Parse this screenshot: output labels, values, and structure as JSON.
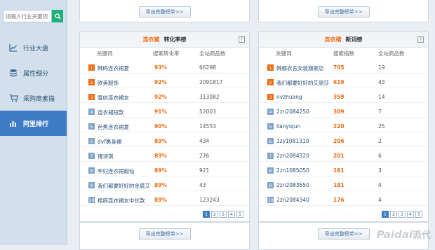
{
  "search": {
    "placeholder": "请输入行业关键词"
  },
  "menu": [
    {
      "label": "行业大盘",
      "icon": "chart-line-icon"
    },
    {
      "label": "属性细分",
      "icon": "layers-icon"
    },
    {
      "label": "采购商素描",
      "icon": "cart-icon"
    },
    {
      "label": "阿里排行",
      "icon": "bar-chart-icon",
      "active": true
    }
  ],
  "export_label": "导出完整榜单>>",
  "left_panel": {
    "category": "连衣裙",
    "title": "转化率榜",
    "help": "?",
    "columns": [
      "关键词",
      "搜索转化率",
      "全站商品数"
    ],
    "rows": [
      {
        "rank": "1",
        "keyword": "韩码连衣裙夏",
        "value": "93%",
        "count": "66298"
      },
      {
        "rank": "2",
        "keyword": "欧美服饰",
        "value": "92%",
        "count": "2091817"
      },
      {
        "rank": "3",
        "keyword": "雪纺连衣裙女",
        "value": "92%",
        "count": "313082"
      },
      {
        "rank": "4",
        "keyword": "连衣裙短款",
        "value": "91%",
        "count": "52003"
      },
      {
        "rank": "5",
        "keyword": "芭蕉连衣裙夏",
        "value": "90%",
        "count": "14553"
      },
      {
        "rank": "6",
        "keyword": "dvf裹身裙",
        "value": "89%",
        "count": "434"
      },
      {
        "rank": "7",
        "keyword": "博诗琪",
        "value": "89%",
        "count": "276"
      },
      {
        "rank": "8",
        "keyword": "孕妇连衣裙超仙",
        "value": "89%",
        "count": "921"
      },
      {
        "rank": "9",
        "keyword": "我们都要好好的金晨艾",
        "value": "89%",
        "count": "43"
      },
      {
        "rank": "10",
        "keyword": "棉麻连衣裙女中长款",
        "value": "89%",
        "count": "123243"
      }
    ]
  },
  "right_panel": {
    "category": "连衣裙",
    "title": "新词榜",
    "help": "?",
    "columns": [
      "关键词",
      "搜索指数",
      "全站商品数"
    ],
    "rows": [
      {
        "rank": "1",
        "keyword": "韩都衣舍女装旗舰店",
        "value": "705",
        "count": "19"
      },
      {
        "rank": "2",
        "keyword": "我们都要好好的艾丽莎",
        "value": "619",
        "count": "43"
      },
      {
        "rank": "3",
        "keyword": "nvzhuang",
        "value": "359",
        "count": "14"
      },
      {
        "rank": "4",
        "keyword": "2zn2084250",
        "value": "309",
        "count": "7"
      },
      {
        "rank": "5",
        "keyword": "lianyiqun",
        "value": "220",
        "count": "25"
      },
      {
        "rank": "6",
        "keyword": "1zy1081310",
        "value": "206",
        "count": "2"
      },
      {
        "rank": "7",
        "keyword": "2zn2084320",
        "value": "201",
        "count": "6"
      },
      {
        "rank": "8",
        "keyword": "2zn1085050",
        "value": "181",
        "count": "3"
      },
      {
        "rank": "9",
        "keyword": "2zn2083550",
        "value": "181",
        "count": "4"
      },
      {
        "rank": "10",
        "keyword": "2zn2084340",
        "value": "176",
        "count": "4"
      }
    ]
  },
  "pages": [
    "1",
    "2",
    "3",
    "4",
    "5"
  ],
  "watermark": {
    "latin": "Paidai",
    "cn": "派代"
  },
  "colors": {
    "rank_top": "#f06a10",
    "rank_rest": "#7fa3c9",
    "accent": "#3f7cc5",
    "value": "#f06a10"
  }
}
